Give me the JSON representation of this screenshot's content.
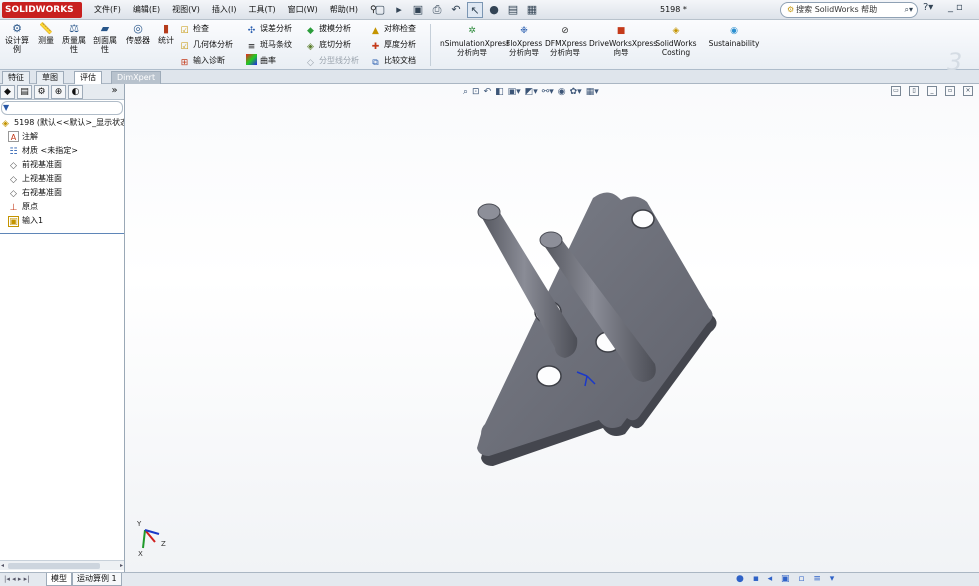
{
  "app": {
    "logo": "SOLIDWORKS",
    "document_title": "5198 *",
    "menu": [
      "文件(F)",
      "编辑(E)",
      "视图(V)",
      "插入(I)",
      "工具(T)",
      "窗口(W)",
      "帮助(H)"
    ],
    "help_search_placeholder": "搜索 SolidWorks 帮助"
  },
  "ribbon": {
    "big_buttons": [
      {
        "label": "设计算例",
        "icon": "study-icon"
      },
      {
        "label": "测量",
        "icon": "measure-icon"
      },
      {
        "label": "质量属性",
        "icon": "mass-properties-icon"
      },
      {
        "label": "剖面属性",
        "icon": "section-properties-icon"
      },
      {
        "label": "传感器",
        "icon": "sensor-icon"
      },
      {
        "label": "统计",
        "icon": "statistics-icon"
      }
    ],
    "col1": [
      {
        "label": "检查",
        "icon": "check-icon"
      },
      {
        "label": "几何体分析",
        "icon": "geometry-analysis-icon"
      },
      {
        "label": "输入诊断",
        "icon": "import-diagnostics-icon"
      }
    ],
    "col2": [
      {
        "label": "误差分析",
        "icon": "deviation-analysis-icon"
      },
      {
        "label": "斑马条纹",
        "icon": "zebra-stripes-icon"
      },
      {
        "label": "曲率",
        "icon": "curvature-icon"
      }
    ],
    "col3": [
      {
        "label": "拔模分析",
        "icon": "draft-analysis-icon",
        "dim": false
      },
      {
        "label": "底切分析",
        "icon": "undercut-analysis-icon",
        "dim": false
      },
      {
        "label": "分型线分析",
        "icon": "parting-line-icon",
        "dim": true
      }
    ],
    "col4": [
      {
        "label": "对称检查",
        "icon": "symmetry-check-icon"
      },
      {
        "label": "厚度分析",
        "icon": "thickness-analysis-icon"
      },
      {
        "label": "比较文档",
        "icon": "compare-documents-icon"
      }
    ],
    "addins": [
      {
        "line1": "nSimulationXpress",
        "line2": "分析向导",
        "icon": "simulation-icon"
      },
      {
        "line1": "FloXpress",
        "line2": "分析向导",
        "icon": "floxpress-icon"
      },
      {
        "line1": "DFMXpress",
        "line2": "分析向导",
        "icon": "dfmxpress-icon"
      },
      {
        "line1": "DriveWorksXpress",
        "line2": "向导",
        "icon": "driveworks-icon"
      },
      {
        "line1": "SolidWorks",
        "line2": "Costing",
        "icon": "costing-icon"
      },
      {
        "line1": "Sustainability",
        "line2": "",
        "icon": "sustainability-icon"
      }
    ]
  },
  "tabs": [
    {
      "label": "特征",
      "state": "normal"
    },
    {
      "label": "草图",
      "state": "normal"
    },
    {
      "label": "评估",
      "state": "active"
    },
    {
      "label": "DimXpert",
      "state": "dim"
    }
  ],
  "tree": {
    "root": "5198  (默认<<默认>_显示状态",
    "items": [
      {
        "label": "注解",
        "icon": "annotations-icon"
      },
      {
        "label": "材质 <未指定>",
        "icon": "material-icon"
      },
      {
        "label": "前视基准面",
        "icon": "plane-icon"
      },
      {
        "label": "上视基准面",
        "icon": "plane-icon"
      },
      {
        "label": "右视基准面",
        "icon": "plane-icon"
      },
      {
        "label": "原点",
        "icon": "origin-icon"
      },
      {
        "label": "输入1",
        "icon": "imported-body-icon"
      }
    ]
  },
  "bottom_tabs": [
    "模型",
    "运动算例 1"
  ],
  "colors": {
    "logo_red": "#c8201f",
    "part_gray": "#6c6e78",
    "accent_blue": "#2857a5"
  }
}
